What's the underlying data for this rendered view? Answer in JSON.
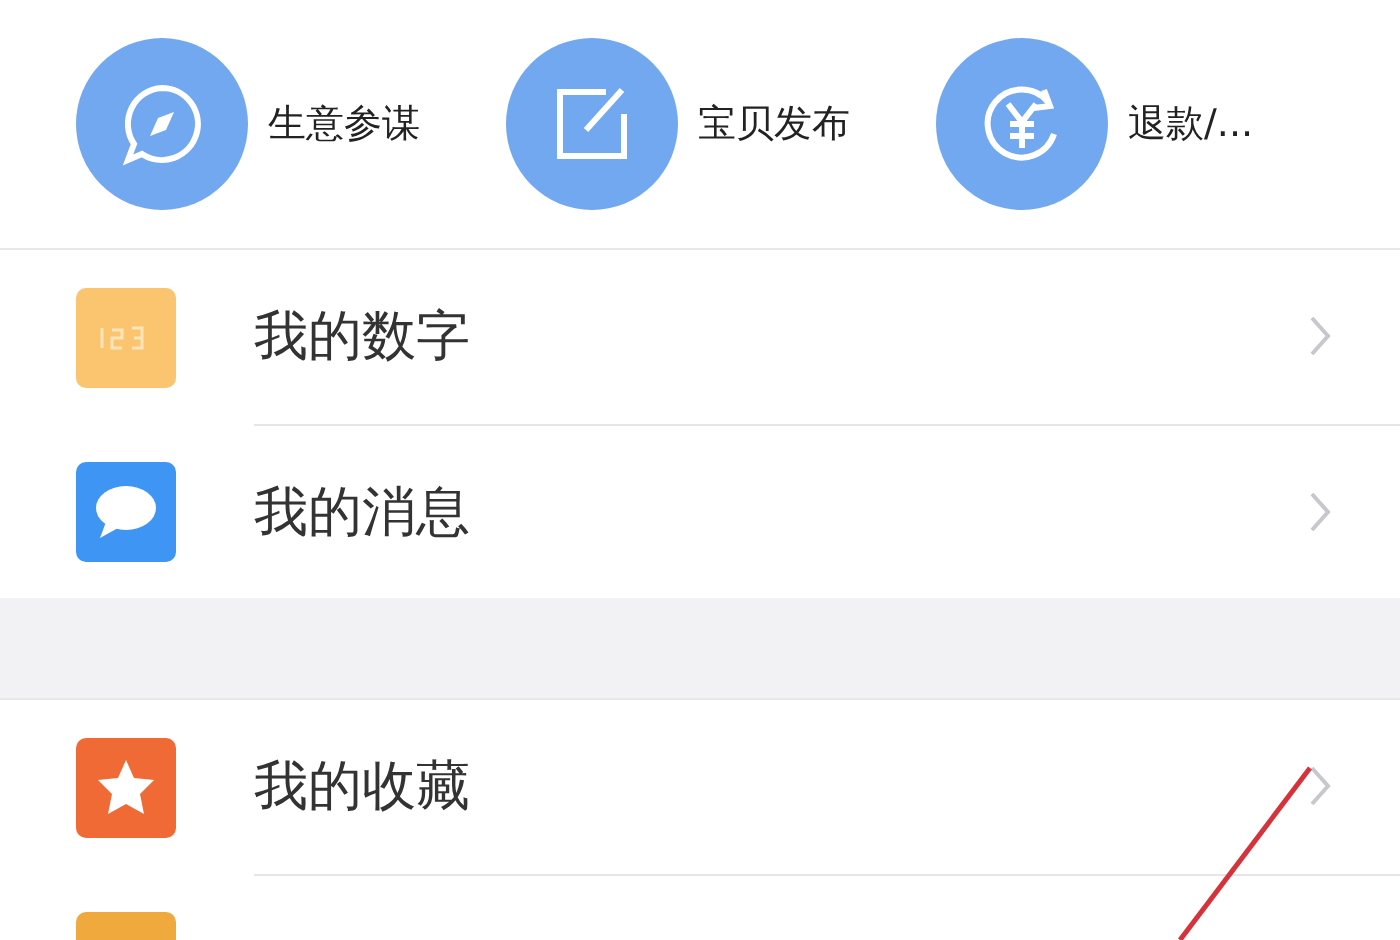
{
  "shortcuts": [
    {
      "label": "生意参谋",
      "kind": "compass"
    },
    {
      "label": "宝贝发布",
      "kind": "edit"
    },
    {
      "label": "退款/...",
      "kind": "refund"
    }
  ],
  "groups": [
    {
      "items": [
        {
          "label": "我的数字",
          "kind": "numbers",
          "color": "#fbc46f"
        },
        {
          "label": "我的消息",
          "kind": "chat",
          "color": "#3f95f3"
        }
      ]
    },
    {
      "items": [
        {
          "label": "我的收藏",
          "kind": "star",
          "color": "#ef6a35"
        },
        {
          "kind": "blank",
          "color": "#efa93c"
        }
      ]
    }
  ]
}
